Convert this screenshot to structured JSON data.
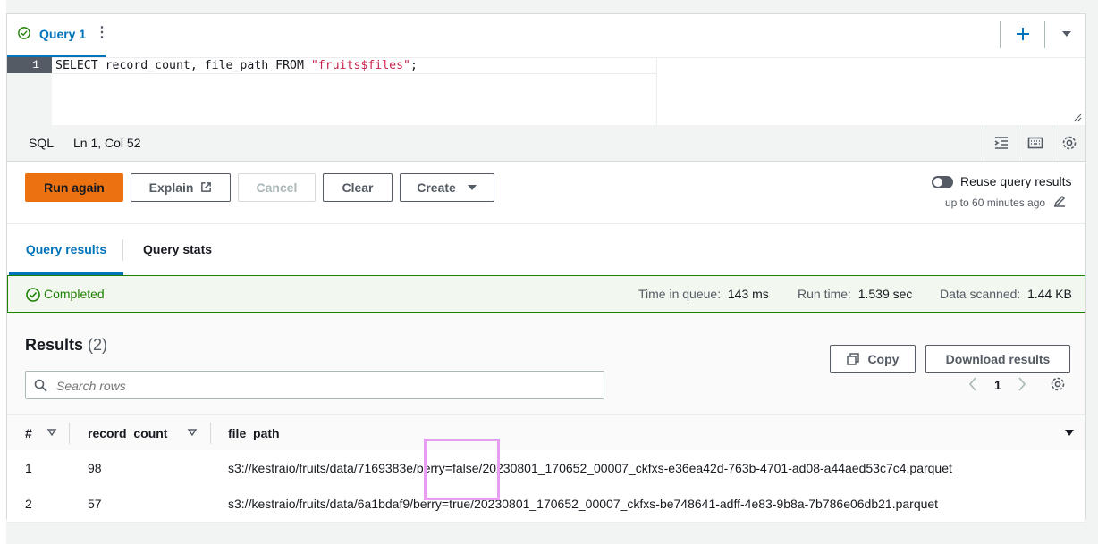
{
  "query_tab": {
    "label": "Query 1",
    "status_icon": "check-circle-icon"
  },
  "editor": {
    "line_number": "1",
    "code_prefix": "SELECT record_count, file_path FROM ",
    "code_string": "\"fruits$files\"",
    "code_suffix": ";"
  },
  "status_bar": {
    "language": "SQL",
    "cursor": "Ln 1, Col 52"
  },
  "actions": {
    "run_again": "Run again",
    "explain": "Explain",
    "cancel": "Cancel",
    "clear": "Clear",
    "create": "Create",
    "reuse_label": "Reuse query results",
    "reuse_sub": "up to 60 minutes ago"
  },
  "result_tabs": {
    "results": "Query results",
    "stats": "Query stats"
  },
  "completion": {
    "status": "Completed",
    "queue_label": "Time in queue:",
    "queue_value": "143 ms",
    "run_label": "Run time:",
    "run_value": "1.539 sec",
    "scanned_label": "Data scanned:",
    "scanned_value": "1.44 KB"
  },
  "results": {
    "title": "Results",
    "count": "(2)",
    "copy": "Copy",
    "download": "Download results",
    "search_placeholder": "Search rows",
    "page": "1"
  },
  "table": {
    "columns": [
      "#",
      "record_count",
      "file_path"
    ],
    "rows": [
      {
        "num": "1",
        "record_count": "98",
        "file_path": "s3://kestraio/fruits/data/7169383e/berry=false/20230801_170652_00007_ckfxs-e36ea42d-763b-4701-ad08-a44aed53c7c4.parquet"
      },
      {
        "num": "2",
        "record_count": "57",
        "file_path": "s3://kestraio/fruits/data/6a1bdaf9/berry=true/20230801_170652_00007_ckfxs-be748641-adff-4e83-9b8a-7b786e06db21.parquet"
      }
    ]
  },
  "colors": {
    "accent": "#0073bb",
    "primary_button": "#ec7211",
    "success": "#1d8102",
    "highlight": "#e79ef0"
  }
}
